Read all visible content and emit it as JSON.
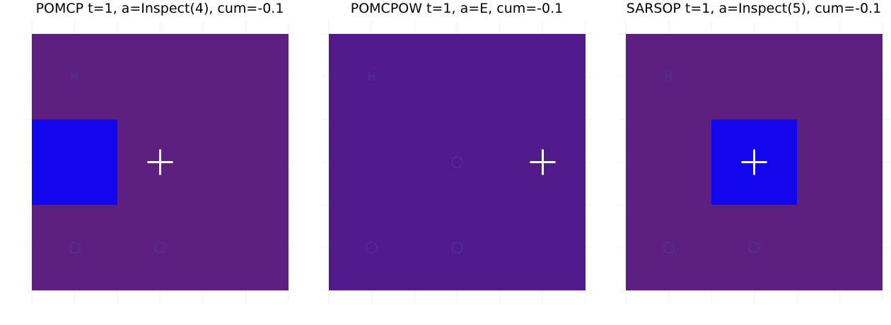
{
  "chart_data": [
    {
      "type": "heatmap",
      "title": "POMCP  t=1, a=Inspect(4), cum=-0.1",
      "grid": {
        "cols": 6,
        "rows": 6
      },
      "background_color": "#5d1f80",
      "highlight_color": "#1206ec",
      "highlights": [
        {
          "col": 1,
          "row": 3,
          "w": 2,
          "h": 2
        }
      ],
      "agent": {
        "col": 3,
        "row": 3
      },
      "markers": [
        {
          "col": 1,
          "row": 5,
          "symbol": "H"
        },
        {
          "col": 1,
          "row": 1,
          "symbol": "circle"
        },
        {
          "col": 3,
          "row": 1,
          "symbol": "circle"
        }
      ]
    },
    {
      "type": "heatmap",
      "title": "POMCPOW  t=1, a=E, cum=-0.1",
      "grid": {
        "cols": 6,
        "rows": 6
      },
      "background_color": "#521b8c",
      "highlight_color": "#1206ec",
      "highlights": [],
      "agent": {
        "col": 5,
        "row": 3
      },
      "markers": [
        {
          "col": 1,
          "row": 5,
          "symbol": "H"
        },
        {
          "col": 3,
          "row": 3,
          "symbol": "circle"
        },
        {
          "col": 1,
          "row": 1,
          "symbol": "circle"
        },
        {
          "col": 3,
          "row": 1,
          "symbol": "circle"
        }
      ]
    },
    {
      "type": "heatmap",
      "title": "SARSOP  t=1, a=Inspect(5), cum=-0.1",
      "grid": {
        "cols": 6,
        "rows": 6
      },
      "background_color": "#5d1f80",
      "highlight_color": "#1206ec",
      "highlights": [
        {
          "col": 3,
          "row": 3,
          "w": 2,
          "h": 2
        }
      ],
      "agent": {
        "col": 3,
        "row": 3
      },
      "markers": [
        {
          "col": 1,
          "row": 5,
          "symbol": "H"
        },
        {
          "col": 1,
          "row": 1,
          "symbol": "circle"
        },
        {
          "col": 3,
          "row": 1,
          "symbol": "circle"
        }
      ]
    }
  ]
}
